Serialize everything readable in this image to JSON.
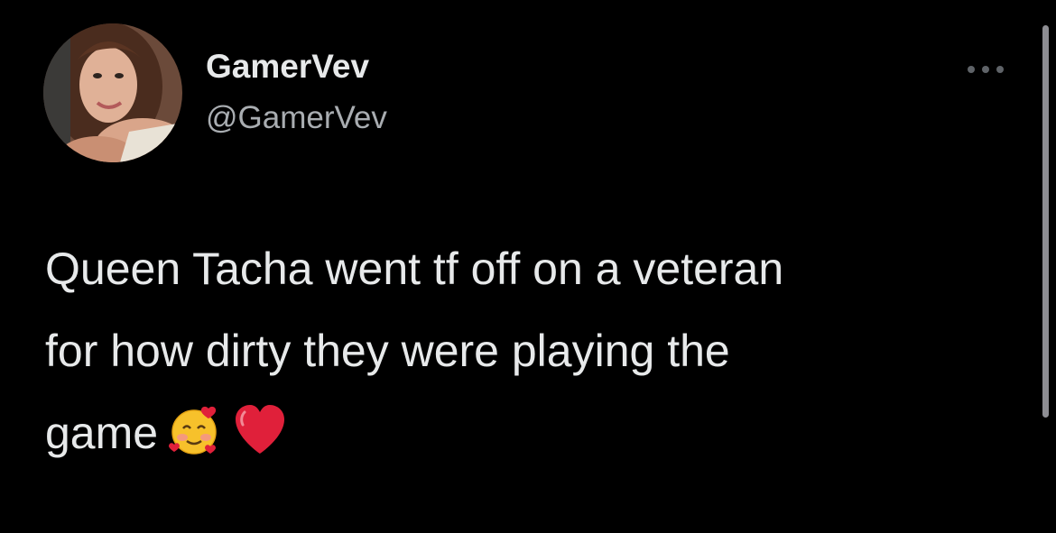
{
  "author": {
    "display_name": "GamerVev",
    "handle": "@GamerVev",
    "avatar_icon": "profile-photo"
  },
  "tweet": {
    "text": "Queen Tacha went tf off on a veteran\nfor how dirty they were playing the\ngame",
    "emojis": [
      "smiling-face-with-hearts",
      "red-heart"
    ]
  },
  "actions": {
    "more_icon": "more-options-icon"
  },
  "colors": {
    "background": "#000000",
    "primary_text": "#e7e9ea",
    "secondary_text": "#a9adb1",
    "heart": "#e0203a"
  }
}
